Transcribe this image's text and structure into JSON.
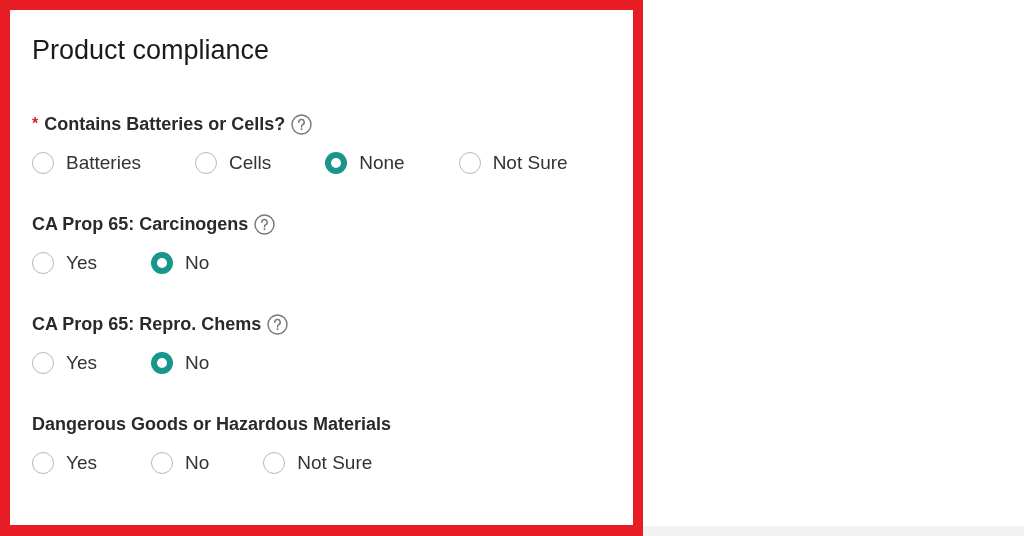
{
  "title": "Product compliance",
  "questions": [
    {
      "label": "Contains Batteries or Cells?",
      "required_marker": "*",
      "help": true,
      "options": [
        {
          "label": "Batteries",
          "selected": false
        },
        {
          "label": "Cells",
          "selected": false
        },
        {
          "label": "None",
          "selected": true
        },
        {
          "label": "Not Sure",
          "selected": false
        }
      ]
    },
    {
      "label": "CA Prop 65: Carcinogens",
      "help": true,
      "options": [
        {
          "label": "Yes",
          "selected": false
        },
        {
          "label": "No",
          "selected": true
        }
      ]
    },
    {
      "label": "CA Prop 65: Repro. Chems",
      "help": true,
      "options": [
        {
          "label": "Yes",
          "selected": false
        },
        {
          "label": "No",
          "selected": true
        }
      ]
    },
    {
      "label": "Dangerous Goods or Hazardous Materials",
      "help": false,
      "options": [
        {
          "label": "Yes",
          "selected": false
        },
        {
          "label": "No",
          "selected": false
        },
        {
          "label": "Not Sure",
          "selected": false
        }
      ]
    }
  ]
}
